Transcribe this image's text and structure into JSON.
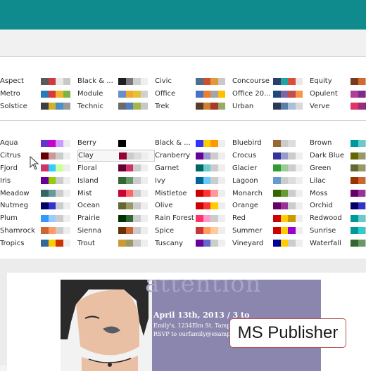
{
  "watermark": "MS Publisher",
  "poster": {
    "title_fragment": "attention",
    "line1": "April 13th, 2013 / 3 to",
    "line2": "Emily's, 1234Elm St. Tampa",
    "line3": "RSVP to ourfamily@example.com"
  },
  "builtin_schemes": [
    [
      {
        "name": "Aspect",
        "colors": [
          "#5a5a5a",
          "#ce3b3b",
          "#e8e8e8",
          "#c8c8c8"
        ]
      },
      {
        "name": "Black & ...",
        "colors": [
          "#1e1e1e",
          "#7a7a7a",
          "#d0d0d0",
          "#efefef"
        ]
      },
      {
        "name": "Civic",
        "colors": [
          "#4c6f8c",
          "#d04f2f",
          "#e19a3a",
          "#c8c8c8"
        ]
      },
      {
        "name": "Concourse",
        "colors": [
          "#2b3f6e",
          "#20a4a0",
          "#d84e3a",
          "#e8e8e8"
        ]
      },
      {
        "name": "Equity",
        "colors": [
          "#7a3a1f",
          "#d46a2a",
          "#b9b9b9",
          "#e1e1e1"
        ]
      },
      {
        "name": "",
        "colors": [
          "#1b8eaa",
          "#0a6f8e",
          "#e0e0e0",
          "#d0d0d0"
        ]
      }
    ],
    [
      {
        "name": "Metro",
        "colors": [
          "#2979b8",
          "#d83a3a",
          "#f2b32f",
          "#7cb342"
        ]
      },
      {
        "name": "Module",
        "colors": [
          "#6a8fc8",
          "#f0a830",
          "#e3c23a",
          "#d0d0d0"
        ]
      },
      {
        "name": "Office",
        "colors": [
          "#4472c4",
          "#ed7d31",
          "#a5a5a5",
          "#ffc000"
        ]
      },
      {
        "name": "Office 20...",
        "colors": [
          "#1f497d",
          "#8064a2",
          "#c0504d",
          "#f79646"
        ]
      },
      {
        "name": "Opulent",
        "colors": [
          "#b13f9a",
          "#7b2d8c",
          "#e06aa8",
          "#f2a2cc"
        ]
      },
      {
        "name": "",
        "colors": [
          "#1a6aa8",
          "#2b9ad8",
          "#d8d8d8",
          "#bdbdbd"
        ]
      }
    ],
    [
      {
        "name": "Solstice",
        "colors": [
          "#3f3f3f",
          "#d3b12a",
          "#4a90c2",
          "#9a9a9a"
        ]
      },
      {
        "name": "Technic",
        "colors": [
          "#6b6b6b",
          "#4f81bd",
          "#a4b54a",
          "#c8c8c8"
        ]
      },
      {
        "name": "Trek",
        "colors": [
          "#5a3a2a",
          "#d08030",
          "#a83a2a",
          "#9aa86a"
        ]
      },
      {
        "name": "Urban",
        "colors": [
          "#2b3a52",
          "#5a7fa8",
          "#a8c0d8",
          "#d8d8d8"
        ]
      },
      {
        "name": "Verve",
        "colors": [
          "#e0356a",
          "#9c2b7a",
          "#5b2d8e",
          "#e8e8e8"
        ]
      },
      {
        "name": "",
        "colors": [
          "#1e8c9a",
          "#40b0a8",
          "#d0d0d0",
          "#e0e0e0"
        ]
      }
    ]
  ],
  "custom_schemes": [
    [
      {
        "name": "Aqua",
        "colors": [
          "#6633cc",
          "#cc00cc",
          "#cc99ff",
          "#eeeeee"
        ]
      },
      {
        "name": "Berry",
        "colors": [
          "#000000",
          "#ffffff",
          "#ffffff",
          "#ffffff"
        ]
      },
      {
        "name": "Black & ...",
        "colors": [
          "#3333ff",
          "#ffcc00",
          "#ff9900",
          "#eeeeee"
        ]
      },
      {
        "name": "Bluebird",
        "colors": [
          "#996633",
          "#cccccc",
          "#dddddd",
          "#ffffff"
        ]
      },
      {
        "name": "Brown",
        "colors": [
          "#009999",
          "#66cccc",
          "#cccccc",
          "#eeeeee"
        ]
      },
      {
        "name": "",
        "colors": [
          "#ff9933",
          "#ffcc66",
          "#dddddd",
          "#eeeeee"
        ]
      }
    ],
    [
      {
        "name": "Citrus",
        "colors": [
          "#660000",
          "#cc9999",
          "#cccccc",
          "#eeeeee"
        ]
      },
      {
        "name": "Clay",
        "colors": [
          "#990033",
          "#cccccc",
          "#dddddd",
          "#eeeeee"
        ]
      },
      {
        "name": "Cranberry",
        "colors": [
          "#660099",
          "#9999cc",
          "#cccccc",
          "#eeeeee"
        ]
      },
      {
        "name": "Crocus",
        "colors": [
          "#333399",
          "#9999cc",
          "#cccccc",
          "#eeeeee"
        ]
      },
      {
        "name": "Dark Blue",
        "colors": [
          "#666600",
          "#999966",
          "#cccccc",
          "#eeeeee"
        ]
      },
      {
        "name": "",
        "colors": [
          "#663300",
          "#996600",
          "#cccccc",
          "#eeeeee"
        ]
      }
    ],
    [
      {
        "name": "Fjord",
        "colors": [
          "#cc3366",
          "#33ccff",
          "#ccff99",
          "#eeeeee"
        ]
      },
      {
        "name": "Floral",
        "colors": [
          "#660033",
          "#cc3366",
          "#cccccc",
          "#eeeeee"
        ]
      },
      {
        "name": "Garnet",
        "colors": [
          "#006666",
          "#66cccc",
          "#cccccc",
          "#eeeeee"
        ]
      },
      {
        "name": "Glacier",
        "colors": [
          "#339933",
          "#99cc99",
          "#cccccc",
          "#eeeeee"
        ]
      },
      {
        "name": "Green",
        "colors": [
          "#666633",
          "#999966",
          "#cccccc",
          "#eeeeee"
        ]
      },
      {
        "name": "",
        "colors": [
          "#336600",
          "#669933",
          "#cccccc",
          "#eeeeee"
        ]
      }
    ],
    [
      {
        "name": "Iris",
        "colors": [
          "#660099",
          "#99cc00",
          "#cccccc",
          "#eeeeee"
        ]
      },
      {
        "name": "Island",
        "colors": [
          "#336633",
          "#669966",
          "#cccccc",
          "#eeeeee"
        ]
      },
      {
        "name": "Ivy",
        "colors": [
          "#006699",
          "#66ccff",
          "#cccccc",
          "#eeeeee"
        ]
      },
      {
        "name": "Lagoon",
        "colors": [
          "#6699cc",
          "#cccccc",
          "#dddddd",
          "#eeeeee"
        ]
      },
      {
        "name": "Lilac",
        "colors": [
          "#993300",
          "#cc6633",
          "#cccccc",
          "#eeeeee"
        ]
      },
      {
        "name": "",
        "colors": [
          "#666633",
          "#999966",
          "#cccccc",
          "#eeeeee"
        ]
      }
    ],
    [
      {
        "name": "Meadow",
        "colors": [
          "#336666",
          "#669999",
          "#cccccc",
          "#eeeeee"
        ]
      },
      {
        "name": "Mist",
        "colors": [
          "#cc0033",
          "#ff6666",
          "#cccccc",
          "#eeeeee"
        ]
      },
      {
        "name": "Mistletoe",
        "colors": [
          "#cc0000",
          "#ff3333",
          "#ff9999",
          "#eeeeee"
        ]
      },
      {
        "name": "Monarch",
        "colors": [
          "#336600",
          "#669933",
          "#cccccc",
          "#eeeeee"
        ]
      },
      {
        "name": "Moss",
        "colors": [
          "#660066",
          "#993399",
          "#cccccc",
          "#eeeeee"
        ]
      },
      {
        "name": "",
        "colors": [
          "#333366",
          "#666699",
          "#cccccc",
          "#eeeeee"
        ]
      }
    ],
    [
      {
        "name": "Nutmeg",
        "colors": [
          "#000066",
          "#3333cc",
          "#cccccc",
          "#eeeeee"
        ]
      },
      {
        "name": "Ocean",
        "colors": [
          "#666633",
          "#999966",
          "#cccccc",
          "#eeeeee"
        ]
      },
      {
        "name": "Olive",
        "colors": [
          "#cc0000",
          "#ff3333",
          "#ffcc00",
          "#eeeeee"
        ]
      },
      {
        "name": "Orange",
        "colors": [
          "#660066",
          "#993399",
          "#cccccc",
          "#eeeeee"
        ]
      },
      {
        "name": "Orchid",
        "colors": [
          "#000066",
          "#3333cc",
          "#cccccc",
          "#eeeeee"
        ]
      },
      {
        "name": "",
        "colors": [
          "#336666",
          "#669999",
          "#cccccc",
          "#eeeeee"
        ]
      }
    ],
    [
      {
        "name": "Plum",
        "colors": [
          "#3399ff",
          "#99ccff",
          "#cccccc",
          "#eeeeee"
        ]
      },
      {
        "name": "Prairie",
        "colors": [
          "#003300",
          "#336633",
          "#cccccc",
          "#eeeeee"
        ]
      },
      {
        "name": "Rain Forest",
        "colors": [
          "#ff3366",
          "#ff99cc",
          "#cccccc",
          "#eeeeee"
        ]
      },
      {
        "name": "Red",
        "colors": [
          "#cc0000",
          "#ffcc00",
          "#cc9900",
          "#eeeeee"
        ]
      },
      {
        "name": "Redwood",
        "colors": [
          "#009999",
          "#66cccc",
          "#cccccc",
          "#eeeeee"
        ]
      },
      {
        "name": "",
        "colors": [
          "#cc3333",
          "#ff6666",
          "#cccccc",
          "#eeeeee"
        ]
      }
    ],
    [
      {
        "name": "Shamrock",
        "colors": [
          "#cc6633",
          "#ff9966",
          "#cccccc",
          "#eeeeee"
        ]
      },
      {
        "name": "Sienna",
        "colors": [
          "#663300",
          "#cc6633",
          "#cccccc",
          "#eeeeee"
        ]
      },
      {
        "name": "Spice",
        "colors": [
          "#cc3333",
          "#ff9966",
          "#ffcc99",
          "#eeeeee"
        ]
      },
      {
        "name": "Summer",
        "colors": [
          "#cc0000",
          "#ffcc00",
          "#9900cc",
          "#eeeeee"
        ]
      },
      {
        "name": "Sunrise",
        "colors": [
          "#009999",
          "#33cccc",
          "#cccccc",
          "#eeeeee"
        ]
      },
      {
        "name": "",
        "colors": [
          "#669966",
          "#99cc99",
          "#cccccc",
          "#eeeeee"
        ]
      }
    ],
    [
      {
        "name": "Tropics",
        "colors": [
          "#336699",
          "#ffcc00",
          "#cc3300",
          "#eeeeee"
        ]
      },
      {
        "name": "Trout",
        "colors": [
          "#cc9933",
          "#999966",
          "#cccccc",
          "#eeeeee"
        ]
      },
      {
        "name": "Tuscany",
        "colors": [
          "#660099",
          "#6666cc",
          "#cccccc",
          "#eeeeee"
        ]
      },
      {
        "name": "Vineyard",
        "colors": [
          "#000099",
          "#ffcc00",
          "#cccccc",
          "#eeeeee"
        ]
      },
      {
        "name": "Waterfall",
        "colors": [
          "#336633",
          "#669966",
          "#cccccc",
          "#eeeeee"
        ]
      },
      {
        "name": "",
        "colors": [
          "#006666",
          "#339999",
          "#cccccc",
          "#eeeeee"
        ]
      }
    ]
  ],
  "hovered_scheme": "Clay"
}
